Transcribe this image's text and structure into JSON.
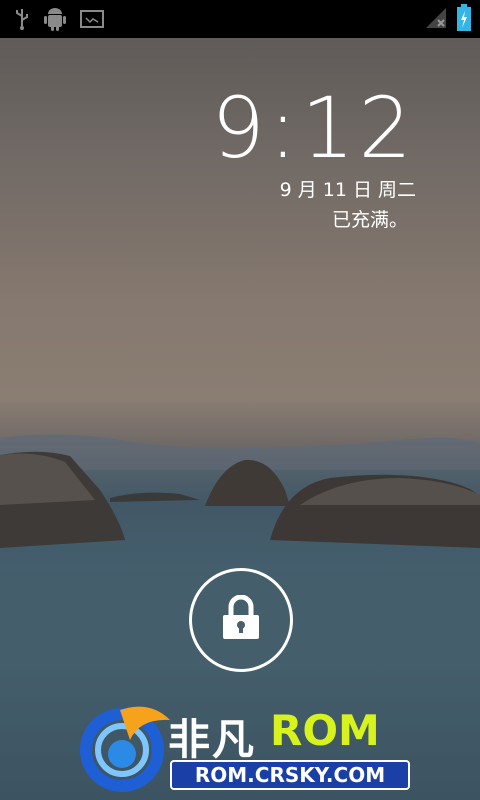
{
  "status_bar": {
    "left_icons": [
      "usb-icon",
      "android-debug-icon",
      "screenshot-icon"
    ],
    "right_icons": [
      "signal-no-service-icon",
      "battery-charging-icon"
    ]
  },
  "lockscreen": {
    "time_hour": "9",
    "time_separator": ":",
    "time_minutes": "12",
    "date": "9 月 11 日 周二",
    "charging_status": "已充满。"
  },
  "lock_icon": "padlock-icon",
  "watermark": {
    "brand_cn": "非凡",
    "brand_en": "ROM",
    "url": "ROM.CRSKY.COM"
  },
  "colors": {
    "status_bar": "#000000",
    "battery_accent": "#33b5e5",
    "watermark_green": "#d7f21c",
    "watermark_blue": "#1a3fa6"
  }
}
